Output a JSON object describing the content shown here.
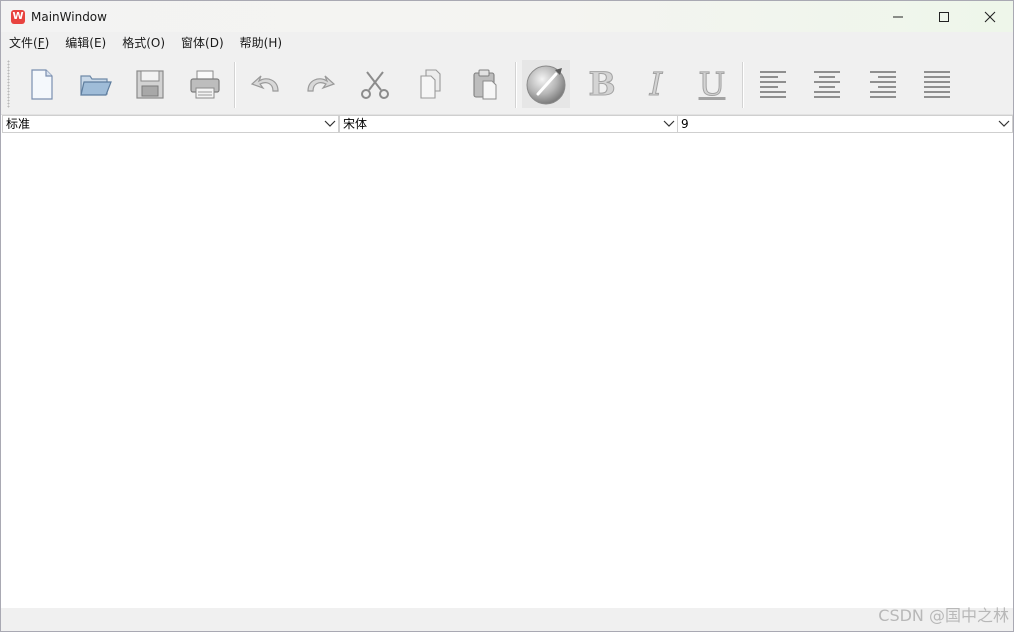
{
  "window": {
    "title": "MainWindow",
    "app_icon": "wps-logo-icon",
    "controls": [
      "minimize-icon",
      "maximize-icon",
      "close-icon"
    ]
  },
  "menubar": {
    "items": [
      {
        "label": "文件(",
        "accel": "F",
        "tail": ")"
      },
      {
        "label": "编辑(E)",
        "accel": "",
        "tail": ""
      },
      {
        "label": "格式(O)",
        "accel": "",
        "tail": ""
      },
      {
        "label": "窗体(D)",
        "accel": "",
        "tail": ""
      },
      {
        "label": "帮助(H)",
        "accel": "",
        "tail": ""
      }
    ]
  },
  "toolbar": {
    "buttons": [
      "new-document-icon",
      "open-folder-icon",
      "save-disk-icon",
      "print-icon",
      "undo-icon",
      "redo-icon",
      "cut-scissors-icon",
      "copy-icon",
      "paste-icon",
      "brush-icon",
      "bold-icon",
      "italic-icon",
      "underline-icon",
      "align-left-icon",
      "align-center-icon",
      "align-right-icon",
      "align-justify-icon"
    ],
    "glyphs": {
      "bold": "B",
      "italic": "I",
      "underline": "U"
    }
  },
  "combos": {
    "style": {
      "value": "标准"
    },
    "font": {
      "value": "宋体"
    },
    "size": {
      "value": "9"
    }
  },
  "watermark": "CSDN @国中之林"
}
